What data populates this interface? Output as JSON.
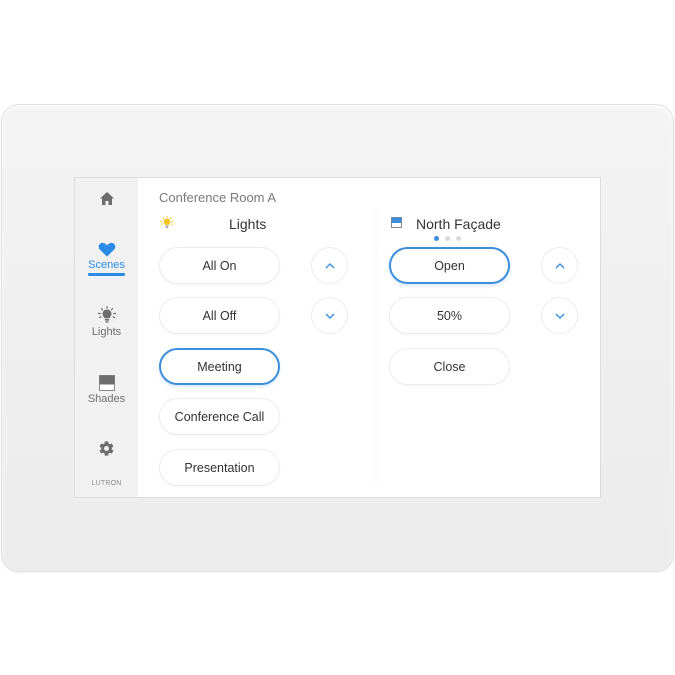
{
  "device": {
    "room_title": "Conference Room A",
    "brand": "LUTRON"
  },
  "sidebar": {
    "items": [
      {
        "id": "home",
        "label": "",
        "icon": "home-icon",
        "active": false
      },
      {
        "id": "scenes",
        "label": "Scenes",
        "icon": "heart-icon",
        "active": true
      },
      {
        "id": "lights",
        "label": "Lights",
        "icon": "lightbulb-icon",
        "active": false
      },
      {
        "id": "shades",
        "label": "Shades",
        "icon": "shade-icon",
        "active": false
      },
      {
        "id": "settings",
        "label": "",
        "icon": "gear-icon",
        "active": false
      }
    ]
  },
  "lights": {
    "title": "Lights",
    "icon": "lightbulb-icon",
    "scenes": [
      {
        "label": "All On",
        "selected": false
      },
      {
        "label": "All Off",
        "selected": false
      },
      {
        "label": "Meeting",
        "selected": true
      },
      {
        "label": "Conference Call",
        "selected": false
      },
      {
        "label": "Presentation",
        "selected": false
      }
    ],
    "raise_icon": "chevron-up-icon",
    "lower_icon": "chevron-down-icon"
  },
  "shades": {
    "title": "North Façade",
    "icon": "shade-icon",
    "page_dots": {
      "count": 3,
      "active": 1
    },
    "presets": [
      {
        "label": "Open",
        "selected": true
      },
      {
        "label": "50%",
        "selected": false
      },
      {
        "label": "Close",
        "selected": false
      }
    ],
    "raise_icon": "chevron-up-icon",
    "lower_icon": "chevron-down-icon"
  },
  "colors": {
    "accent": "#2b8be6",
    "selected_border": "#3d8fdc",
    "sidebar_bg": "#f1f1f2",
    "bulb_yellow": "#f5c518"
  }
}
